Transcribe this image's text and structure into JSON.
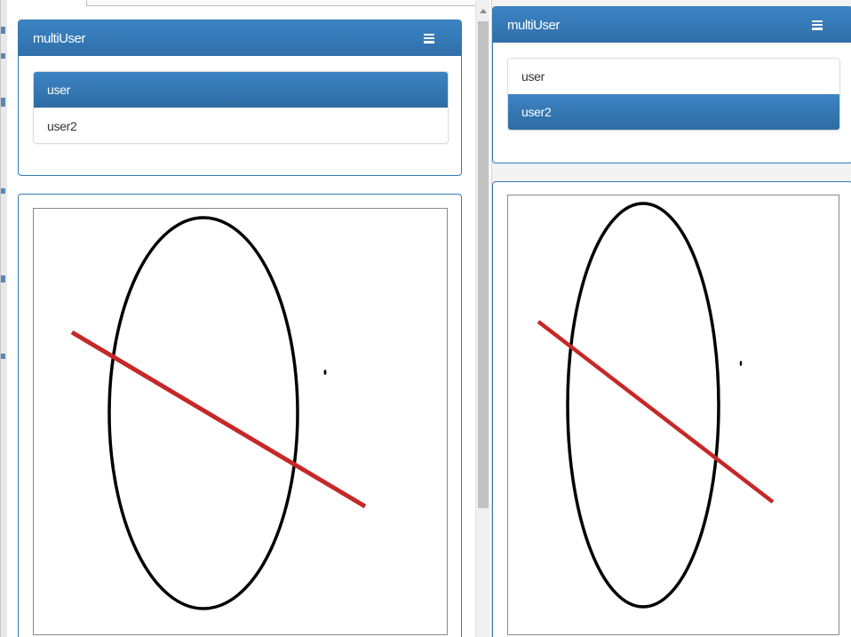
{
  "windows": [
    {
      "app_title": "multiUser",
      "users": [
        {
          "label": "user",
          "active": true
        },
        {
          "label": "user2",
          "active": false
        }
      ]
    },
    {
      "app_title": "multiUser",
      "users": [
        {
          "label": "user",
          "active": false
        },
        {
          "label": "user2",
          "active": true
        }
      ]
    }
  ],
  "colors": {
    "header_blue": "#337ab7",
    "ellipse_stroke": "#000000",
    "line_stroke": "#c62828"
  },
  "icons": {
    "menu": "hamburger-menu-icon"
  }
}
